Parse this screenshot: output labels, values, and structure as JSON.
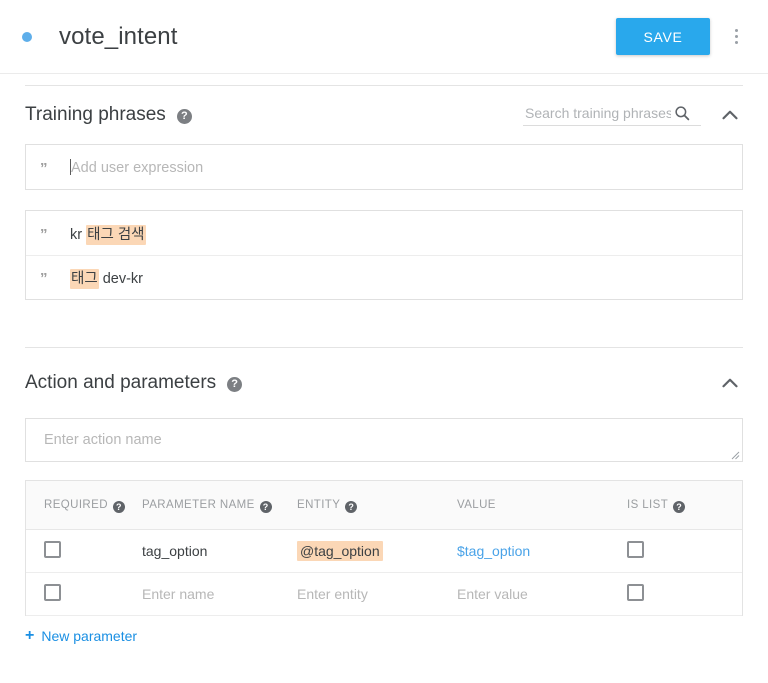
{
  "header": {
    "status_dot": "blue-status-dot",
    "title": "vote_intent",
    "save_label": "SAVE",
    "more_menu": "more-options"
  },
  "training_phrases": {
    "title": "Training phrases",
    "help": "?",
    "search_placeholder": "Search training phrases",
    "search_value": "",
    "collapse_icon": "chevron-up",
    "add_row": {
      "quote": "”",
      "placeholder": "Add user expression"
    },
    "rows": [
      {
        "quote": "”",
        "parts": [
          {
            "text": "kr ",
            "highlight": false
          },
          {
            "text": "태그 검색",
            "highlight": true
          }
        ]
      },
      {
        "quote": "”",
        "parts": [
          {
            "text": "태그",
            "highlight": true
          },
          {
            "text": " dev-kr",
            "highlight": false
          }
        ]
      }
    ]
  },
  "action_and_parameters": {
    "title": "Action and parameters",
    "help": "?",
    "collapse_icon": "chevron-up",
    "action_placeholder": "Enter action name",
    "action_value": "",
    "table": {
      "columns": [
        {
          "label": "REQUIRED",
          "help": "?"
        },
        {
          "label": "PARAMETER NAME",
          "help": "?"
        },
        {
          "label": "ENTITY",
          "help": "?"
        },
        {
          "label": "VALUE",
          "help": ""
        },
        {
          "label": "IS LIST",
          "help": "?"
        }
      ],
      "rows": [
        {
          "required": false,
          "name": "tag_option",
          "name_placeholder": "",
          "entity": "@tag_option",
          "entity_placeholder": "",
          "entity_highlight": true,
          "value": "$tag_option",
          "value_placeholder": "",
          "value_link": true,
          "is_list": false
        },
        {
          "required": false,
          "name": "",
          "name_placeholder": "Enter name",
          "entity": "",
          "entity_placeholder": "Enter entity",
          "entity_highlight": false,
          "value": "",
          "value_placeholder": "Enter value",
          "value_link": false,
          "is_list": false
        }
      ]
    },
    "new_parameter_label": "New parameter",
    "new_parameter_plus": "+"
  },
  "colors": {
    "accent": "#29a8ec",
    "link": "#1a8fe3",
    "highlight": "#fbd7b6",
    "status": "#5eaeea"
  }
}
